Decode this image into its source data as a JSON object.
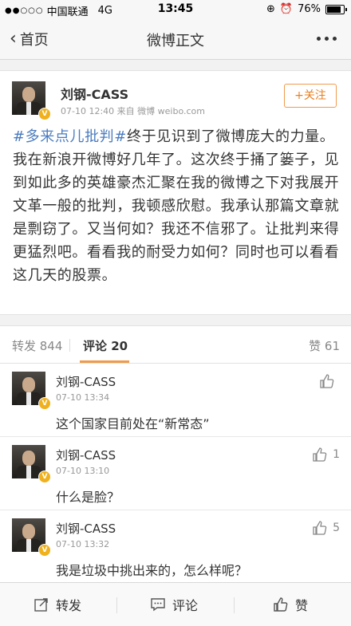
{
  "status_bar": {
    "carrier": "中国联通",
    "network": "4G",
    "time": "13:45",
    "battery": "76%",
    "battery_level": 0.76
  },
  "nav": {
    "back_label": "首页",
    "title": "微博正文"
  },
  "post": {
    "author": "刘钢-CASS",
    "verified_badge": "V",
    "meta": "07-10 12:40  来自 微博 weibo.com",
    "follow_label": "+关注",
    "hashtag": "#多来点儿批判#",
    "text": "终于见识到了微博庞大的力量。我在新浪开微博好几年了。这次终于捅了篓子，见到如此多的英雄豪杰汇聚在我的微博之下对我展开文革一般的批判，我顿感欣慰。我承认那篇文章就是剽窃了。又当何如？我还不信邪了。让批判来得更猛烈吧。看看我的耐受力如何？同时也可以看看这几天的股票。"
  },
  "stats": {
    "repost": "转发 844",
    "comment_label": "评论",
    "comment_count": "20",
    "like": "赞 61"
  },
  "comments": [
    {
      "name": "刘钢-CASS",
      "time": "07-10 13:34",
      "text": "这个国家目前处在“新常态”",
      "likes": ""
    },
    {
      "name": "刘钢-CASS",
      "time": "07-10 13:10",
      "text": "什么是脸？",
      "likes": "1"
    },
    {
      "name": "刘钢-CASS",
      "time": "07-10 13:32",
      "text": "我是垃圾中挑出来的，怎么样呢？",
      "likes": "5"
    }
  ],
  "toolbar": {
    "repost_label": "转发",
    "comment_label": "评论",
    "like_label": "赞"
  },
  "colors": {
    "accent": "#e87f21",
    "hashtag": "#4a7bbf",
    "verified": "#f0b11e"
  }
}
